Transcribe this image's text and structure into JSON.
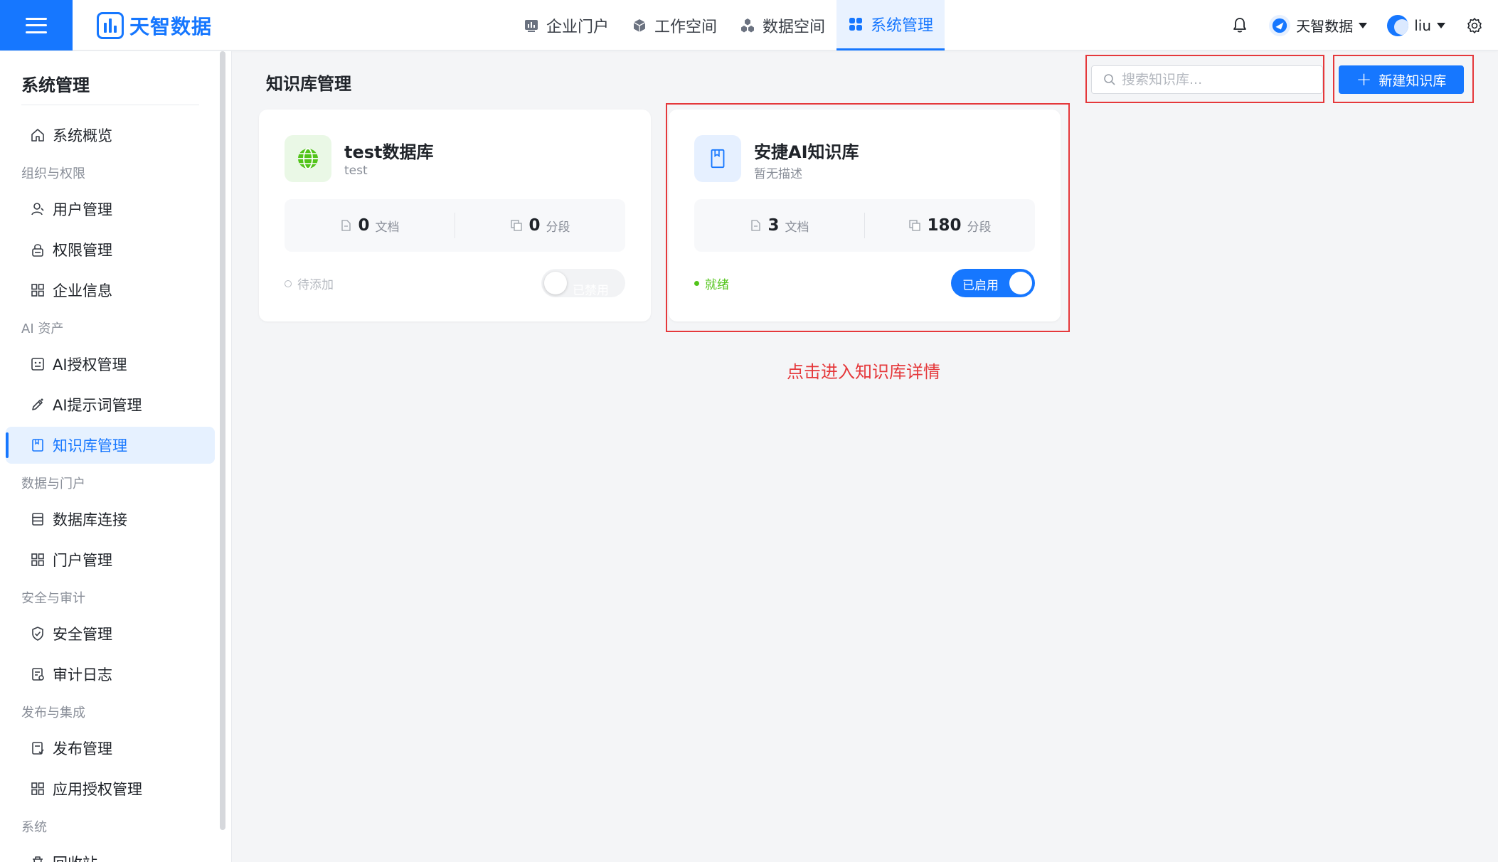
{
  "header": {
    "logo_text": "天智数据",
    "nav": [
      {
        "label": "企业门户",
        "icon": "chart-board-icon",
        "active": false
      },
      {
        "label": "工作空间",
        "icon": "cube-icon",
        "active": false
      },
      {
        "label": "数据空间",
        "icon": "cubes-icon",
        "active": false
      },
      {
        "label": "系统管理",
        "icon": "grid-icon",
        "active": true
      }
    ],
    "org_name": "天智数据",
    "user_name": "liu"
  },
  "sidebar": {
    "title": "系统管理",
    "sections": [
      {
        "group": "",
        "items": [
          {
            "label": "系统概览",
            "icon": "home-icon"
          }
        ]
      },
      {
        "group": "组织与权限",
        "items": [
          {
            "label": "用户管理",
            "icon": "user-icon"
          },
          {
            "label": "权限管理",
            "icon": "lock-icon"
          },
          {
            "label": "企业信息",
            "icon": "grid-icon"
          }
        ]
      },
      {
        "group": "AI 资产",
        "items": [
          {
            "label": "AI授权管理",
            "icon": "robot-icon"
          },
          {
            "label": "AI提示词管理",
            "icon": "pen-icon"
          },
          {
            "label": "知识库管理",
            "icon": "book-icon",
            "active": true
          }
        ]
      },
      {
        "group": "数据与门户",
        "items": [
          {
            "label": "数据库连接",
            "icon": "database-icon"
          },
          {
            "label": "门户管理",
            "icon": "grid-icon"
          }
        ]
      },
      {
        "group": "安全与审计",
        "items": [
          {
            "label": "安全管理",
            "icon": "shield-icon"
          },
          {
            "label": "审计日志",
            "icon": "log-icon"
          }
        ]
      },
      {
        "group": "发布与集成",
        "items": [
          {
            "label": "发布管理",
            "icon": "publish-icon"
          },
          {
            "label": "应用授权管理",
            "icon": "grid-icon"
          }
        ]
      },
      {
        "group": "系统",
        "items": [
          {
            "label": "回收站",
            "icon": "trash-icon"
          }
        ]
      }
    ]
  },
  "main": {
    "title": "知识库管理",
    "search_placeholder": "搜索知识库...",
    "new_button": "新建知识库",
    "cards": [
      {
        "name": "test数据库",
        "desc": "test",
        "icon": "globe-icon",
        "docs": "0",
        "docs_unit": "文档",
        "segments": "0",
        "segments_unit": "分段",
        "status": "待添加",
        "toggle_label": "已禁用",
        "enabled": false
      },
      {
        "name": "安捷AI知识库",
        "desc": "暂无描述",
        "icon": "book-icon",
        "docs": "3",
        "docs_unit": "文档",
        "segments": "180",
        "segments_unit": "分段",
        "status": "就绪",
        "toggle_label": "已启用",
        "enabled": true
      }
    ],
    "annotation": "点击进入知识库详情"
  },
  "colors": {
    "accent": "#1677ff",
    "annotation": "#e5383b",
    "ready": "#52c41a"
  }
}
